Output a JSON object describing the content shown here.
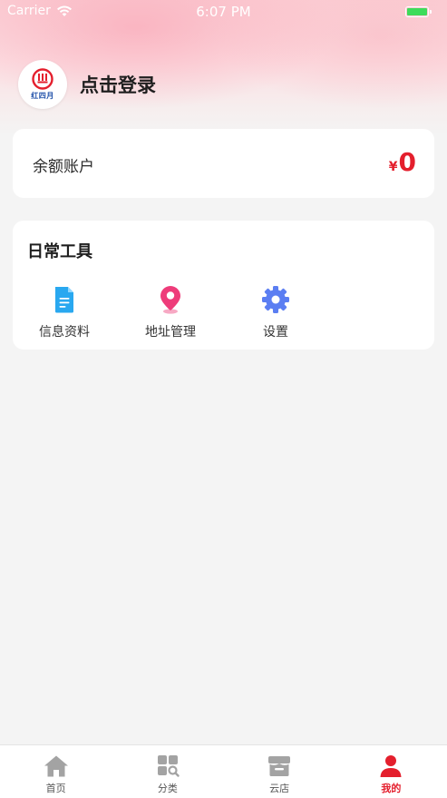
{
  "status_bar": {
    "carrier": "Carrier",
    "time": "6:07 PM"
  },
  "profile": {
    "avatar_text": "红四月",
    "login_label": "点击登录"
  },
  "balance": {
    "label": "余额账户",
    "currency": "¥",
    "amount": "0"
  },
  "tools": {
    "title": "日常工具",
    "items": [
      {
        "label": "信息资料",
        "icon": "document-icon"
      },
      {
        "label": "地址管理",
        "icon": "location-pin-icon"
      },
      {
        "label": "设置",
        "icon": "gear-icon"
      }
    ]
  },
  "tabbar": {
    "items": [
      {
        "label": "首页",
        "icon": "home-icon"
      },
      {
        "label": "分类",
        "icon": "category-icon"
      },
      {
        "label": "云店",
        "icon": "store-icon"
      },
      {
        "label": "我的",
        "icon": "user-icon",
        "active": true
      }
    ]
  },
  "colors": {
    "accent": "#e41f2d",
    "doc_blue": "#29a8f0",
    "pin_pink": "#ee3c7a",
    "gear_blue": "#5b7ef2",
    "tab_gray": "#a3a3a3"
  }
}
